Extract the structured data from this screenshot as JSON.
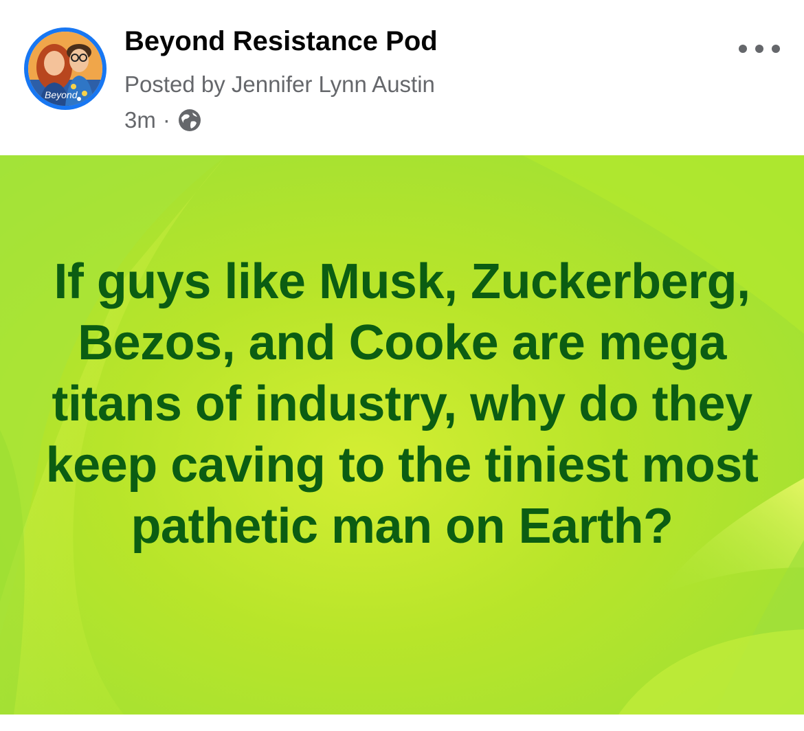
{
  "post": {
    "page_name": "Beyond Resistance Pod",
    "posted_by": "Posted by Jennifer Lynn Austin",
    "timestamp": "3m",
    "separator": "·",
    "audience_icon": "globe-icon",
    "avatar_label": "Beyond",
    "more_icon": "more-options-icon",
    "text": "If guys like Musk, Zuckerberg, Bezos, and Cooke are mega titans of industry, why do they keep caving to the tiniest most pathetic man on Earth?"
  },
  "colors": {
    "text_green": "#0b5d12",
    "background_lime": "#c6ee2a",
    "secondary_text": "#65676b",
    "avatar_ring": "#1877f2"
  }
}
